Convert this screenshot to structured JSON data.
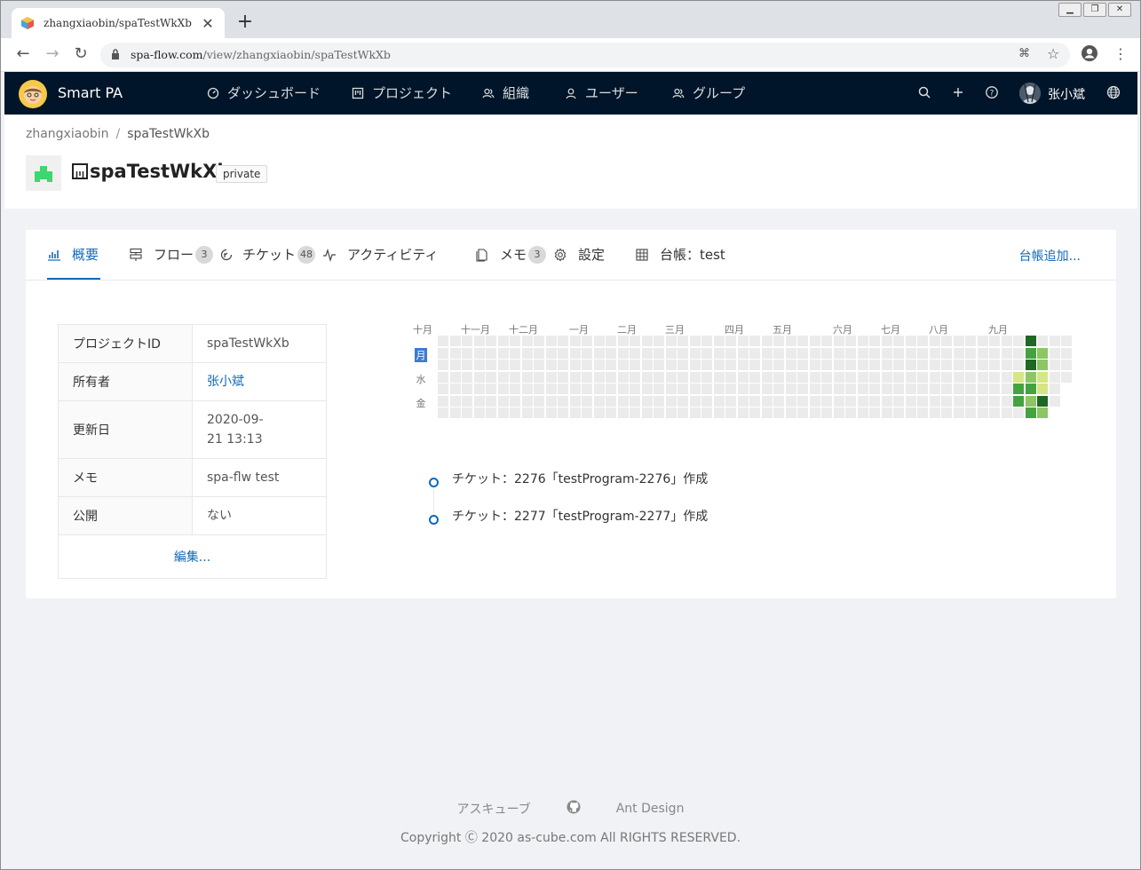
{
  "browser": {
    "tab_title": "zhangxiaobin/spaTestWkXb",
    "url_host": "spa-flow.com",
    "url_path": "/view/zhangxiaobin/spaTestWkXb"
  },
  "app": {
    "brand": "Smart PA",
    "menu": [
      "ダッシュボード",
      "プロジェクト",
      "組織",
      "ユーザー",
      "グループ"
    ],
    "username": "张小斌"
  },
  "breadcrumb": [
    "zhangxiaobin",
    "spaTestWkXb"
  ],
  "project": {
    "name": "spaTestWkXb",
    "visibility": "private"
  },
  "tabs": [
    {
      "label": "概要",
      "icon": "bar-chart-icon"
    },
    {
      "label": "フロー",
      "count": "3",
      "icon": "flow-icon"
    },
    {
      "label": "チケット",
      "count": "48",
      "icon": "ticket-icon"
    },
    {
      "label": "アクティビティ",
      "icon": "activity-icon"
    },
    {
      "label": "メモ",
      "count": "3",
      "icon": "memo-icon"
    },
    {
      "label": "設定",
      "icon": "gear-icon"
    },
    {
      "label": "台帳：test",
      "icon": "table-icon"
    }
  ],
  "add_ledger": "台帳追加...",
  "info": {
    "rows": [
      {
        "key": "プロジェクトID",
        "value": "spaTestWkXb"
      },
      {
        "key": "所有者",
        "value": "张小斌"
      },
      {
        "key": "更新日",
        "value": "2020-09-21 13:13"
      },
      {
        "key": "メモ",
        "value": "spa-flw test"
      },
      {
        "key": "公開",
        "value": "ない"
      }
    ],
    "edit": "編集..."
  },
  "heatmap": {
    "months": [
      "十月",
      "十一月",
      "十二月",
      "一月",
      "二月",
      "三月",
      "四月",
      "五月",
      "六月",
      "七月",
      "八月",
      "九月"
    ],
    "day_labels": [
      "月",
      "水",
      "金"
    ],
    "colors": {
      "empty": "#ebebeb",
      "l1": "#d6e685",
      "l2": "#8cc665",
      "l3": "#44a340",
      "l4": "#1e6823"
    }
  },
  "timeline": [
    "チケット：2276「testProgram-2276」作成",
    "チケット：2277「testProgram-2277」作成"
  ],
  "footer": {
    "links": [
      "アスキューブ",
      "github-icon",
      "Ant Design"
    ],
    "link1": "アスキューブ",
    "link3": "Ant Design",
    "copyright": "Copyright Ⓒ 2020 as-cube.com All RIGHTS RESERVED."
  }
}
